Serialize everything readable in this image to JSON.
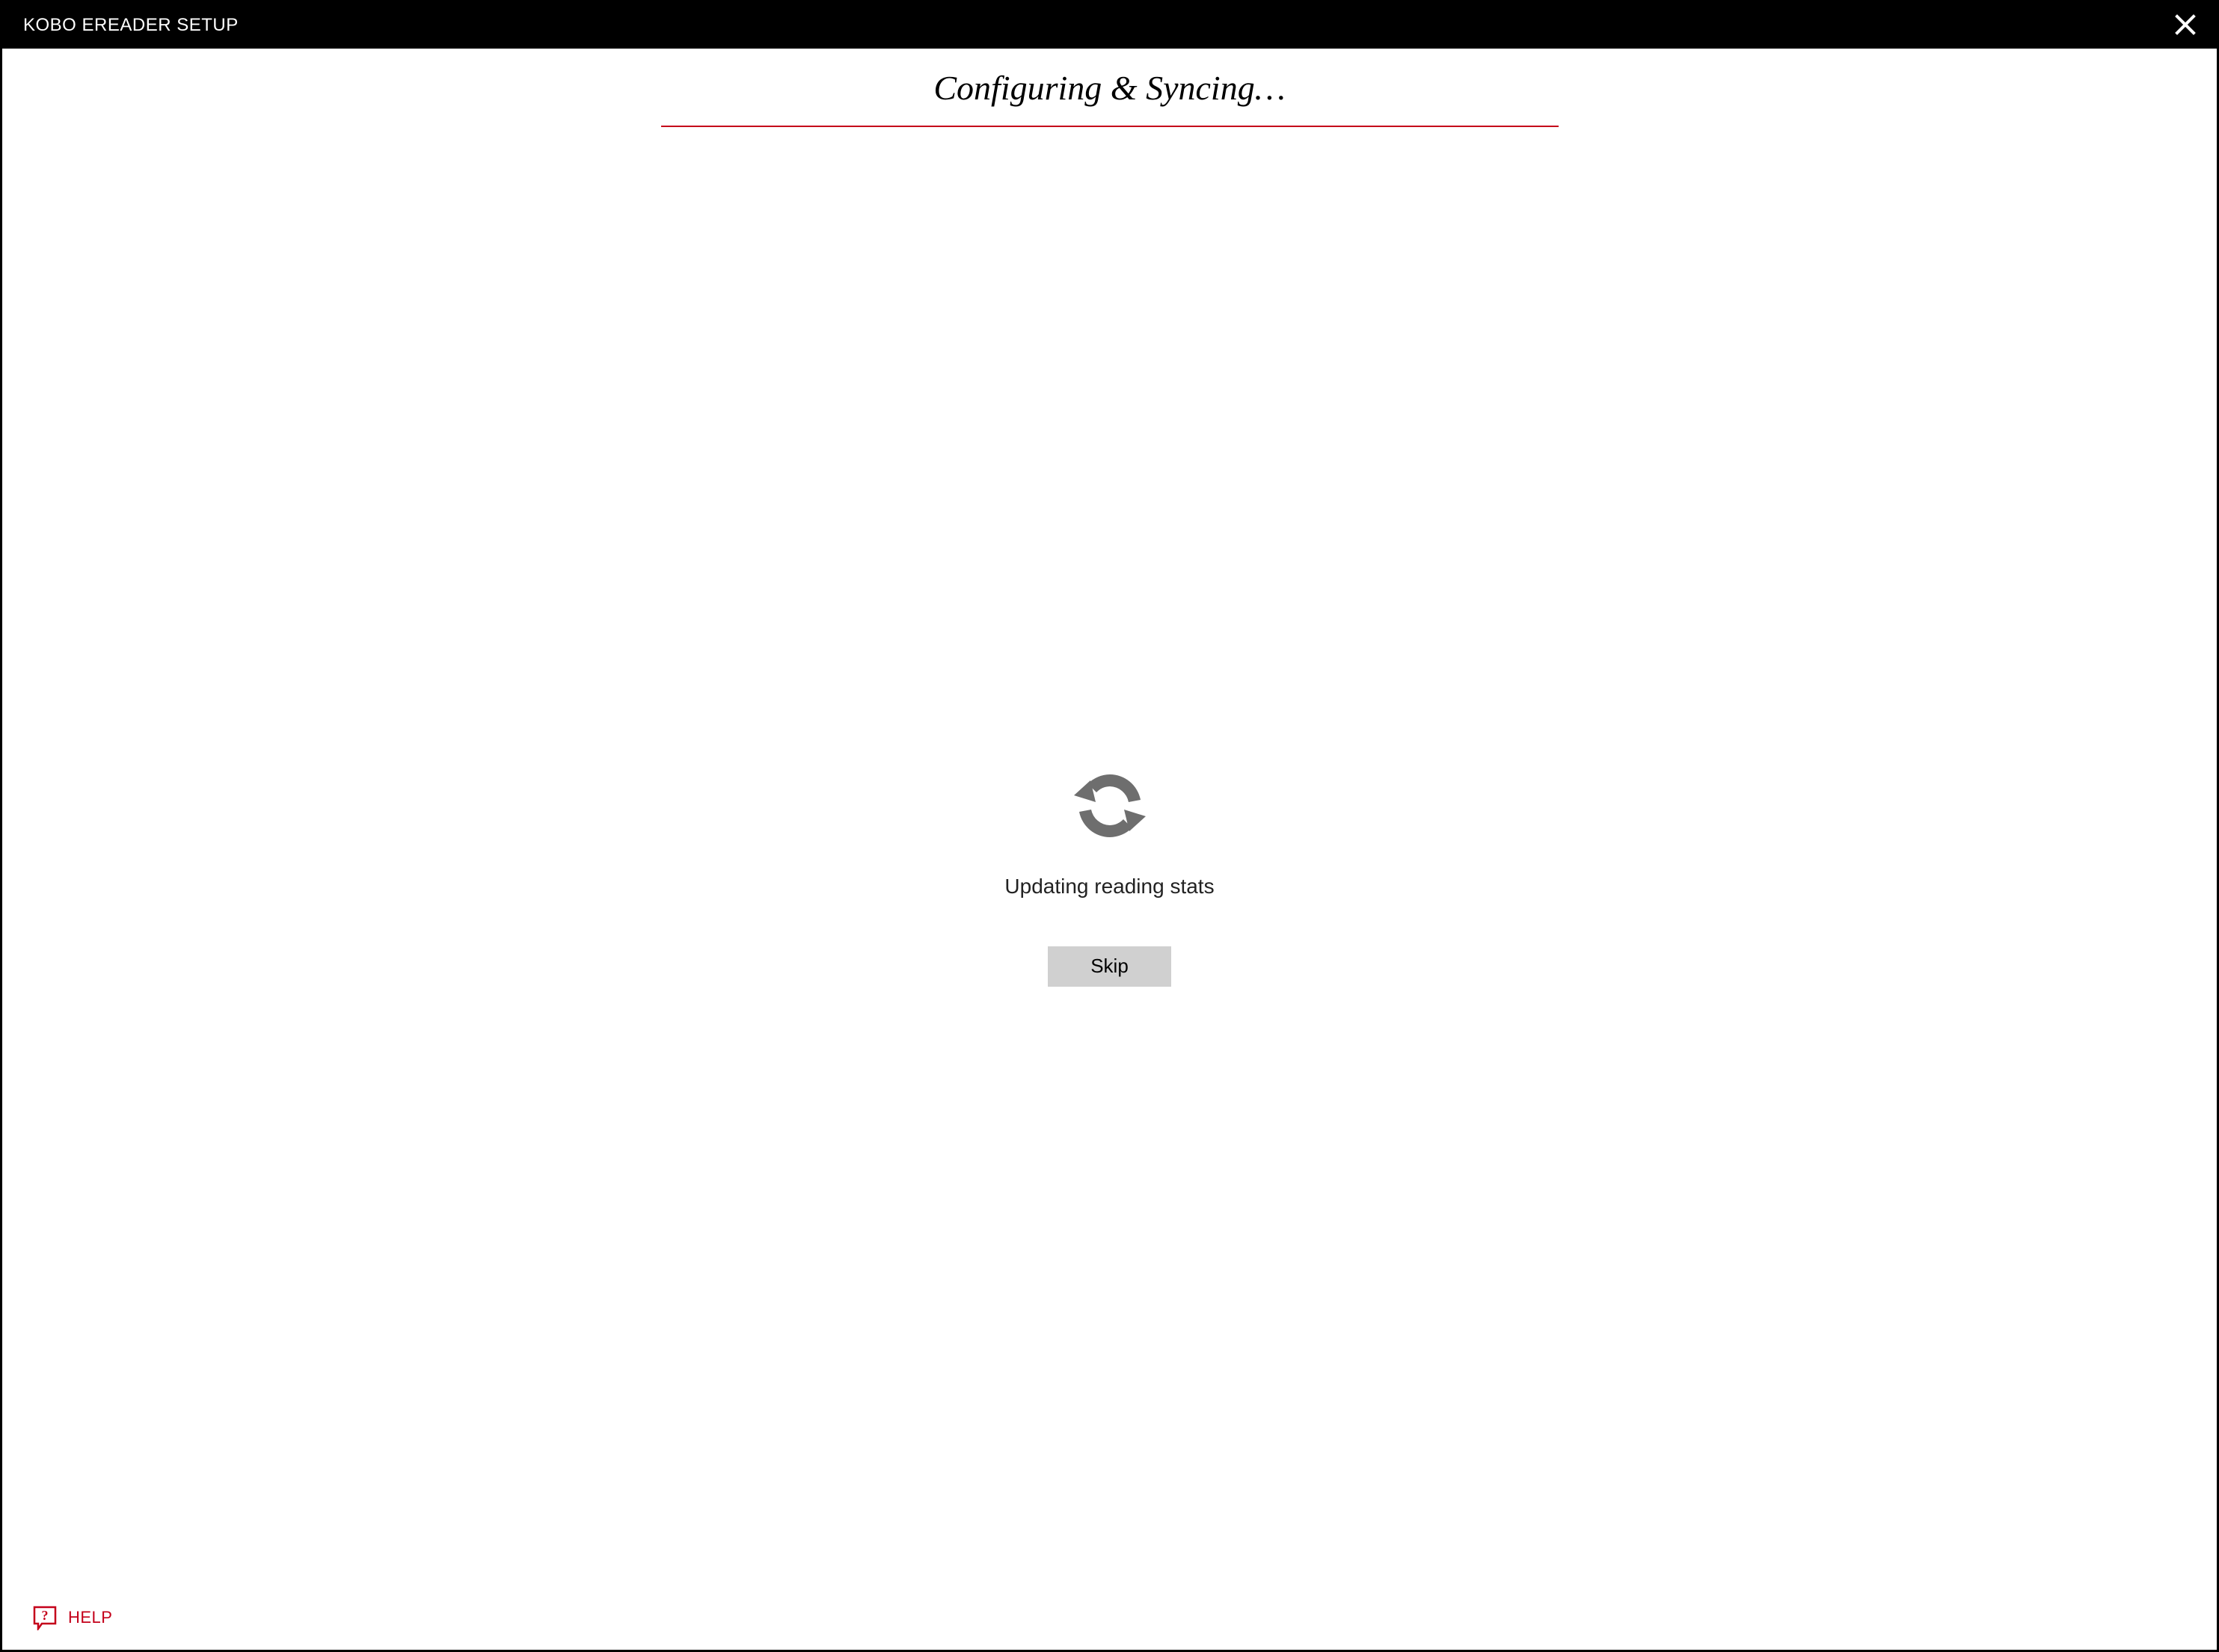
{
  "titlebar": {
    "title": "KOBO EREADER SETUP"
  },
  "main": {
    "heading": "Configuring & Syncing…",
    "status_text": "Updating reading stats",
    "skip_label": "Skip"
  },
  "footer": {
    "help_label": "HELP"
  },
  "colors": {
    "accent": "#c4001a",
    "titlebar_bg": "#000000",
    "button_bg": "#d0d0d0",
    "icon_gray": "#6e6e6e"
  }
}
